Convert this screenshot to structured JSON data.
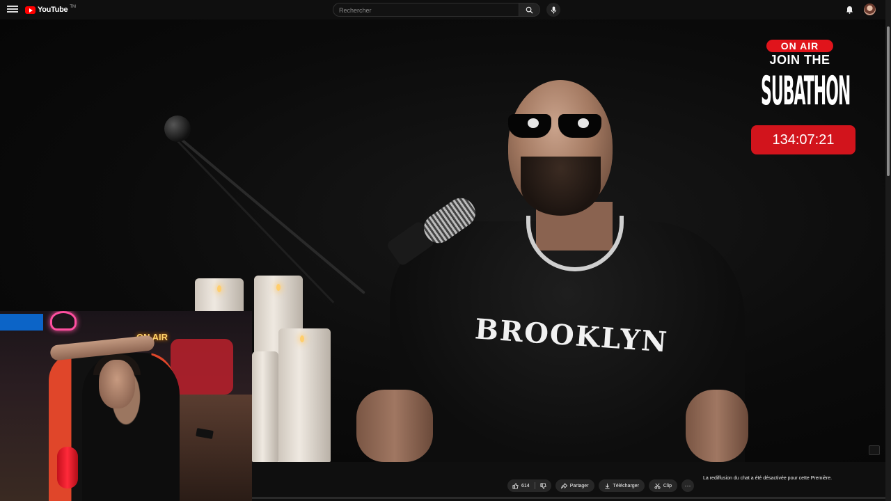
{
  "header": {
    "logo_text": "YouTube",
    "logo_suffix": "TM",
    "search_placeholder": "Rechercher"
  },
  "overlay": {
    "on_air": "ON AIR",
    "join_the": "JOIN THE",
    "subathon": "SUBATHON",
    "timer": "134:07:21"
  },
  "video": {
    "shirt_text": "BROOKLYN",
    "webcam_sign": "ON AIR"
  },
  "actions": {
    "like_count": "614",
    "share_label": "Partager",
    "download_label": "Télécharger",
    "clip_label": "Clip",
    "more_label": "⋯"
  },
  "chat": {
    "disabled_message": "La rediffusion du chat a été désactivée pour cette Première."
  },
  "colors": {
    "brand_red": "#ff0000",
    "overlay_red": "#d2141c",
    "background": "#0f0f0f"
  }
}
